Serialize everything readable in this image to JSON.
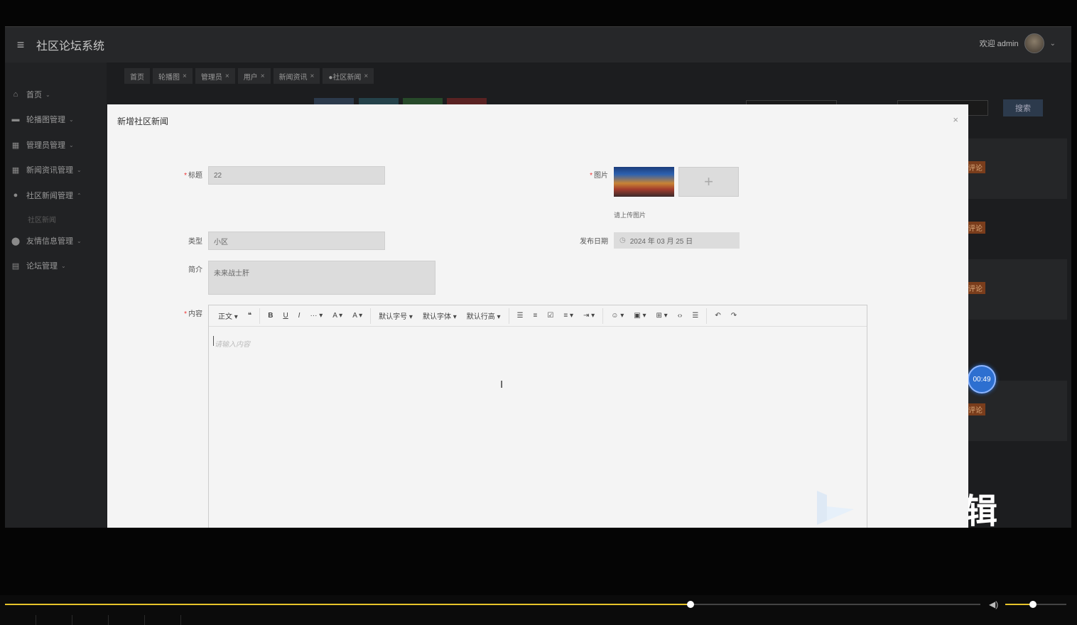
{
  "app": {
    "title": "社区论坛系统",
    "welcome": "欢迎 admin"
  },
  "sidebar": {
    "items": [
      {
        "label": "首页",
        "icon": "home-icon"
      },
      {
        "label": "轮播图管理",
        "icon": "image-icon"
      },
      {
        "label": "管理员管理",
        "icon": "admin-icon"
      },
      {
        "label": "新闻资讯管理",
        "icon": "news-icon"
      },
      {
        "label": "社区新闻管理",
        "icon": "community-icon"
      },
      {
        "label": "友情信息管理",
        "icon": "link-icon"
      },
      {
        "label": "论坛管理",
        "icon": "forum-icon"
      }
    ],
    "sub_item": "社区新闻"
  },
  "tabs": [
    {
      "label": "首页",
      "closable": false
    },
    {
      "label": "轮播图",
      "closable": true
    },
    {
      "label": "管理员",
      "closable": true
    },
    {
      "label": "用户",
      "closable": true
    },
    {
      "label": "新闻资讯",
      "closable": true
    },
    {
      "label": "●社区新闻",
      "closable": true
    }
  ],
  "background": {
    "search_label": "搜索",
    "row_tag": "评论"
  },
  "modal": {
    "title": "新增社区新闻",
    "close": "×",
    "fields": {
      "title_label": "标题",
      "title_value": "22",
      "type_label": "类型",
      "type_value": "小区",
      "summary_label": "简介",
      "summary_value": "未来战士肝",
      "image_label": "图片",
      "image_hint": "请上传图片",
      "upload_symbol": "+",
      "date_label": "发布日期",
      "date_value": "2024 年 03 月 25 日",
      "content_label": "内容"
    },
    "editor": {
      "placeholder": "请输入内容",
      "toolbar": {
        "paragraph": "正文",
        "quote": "❝",
        "bold": "B",
        "underline": "U",
        "italic": "I",
        "more": "···",
        "font_color": "A",
        "bg_color": "A",
        "font_size": "默认字号",
        "font_family": "默认字体",
        "line_height": "默认行高",
        "bullet_list": "☰",
        "numbered_list": "≡",
        "todo": "☑",
        "align": "≡",
        "indent": "⇥",
        "emoji": "☺",
        "image": "▣",
        "table": "⊞",
        "code": "‹›",
        "divider": "☰",
        "undo": "↶",
        "redo": "↷"
      }
    }
  },
  "overlay": {
    "timer": "00:49",
    "watermark_text": "辑"
  },
  "player": {
    "progress": 0.703,
    "volume": 0.45
  }
}
